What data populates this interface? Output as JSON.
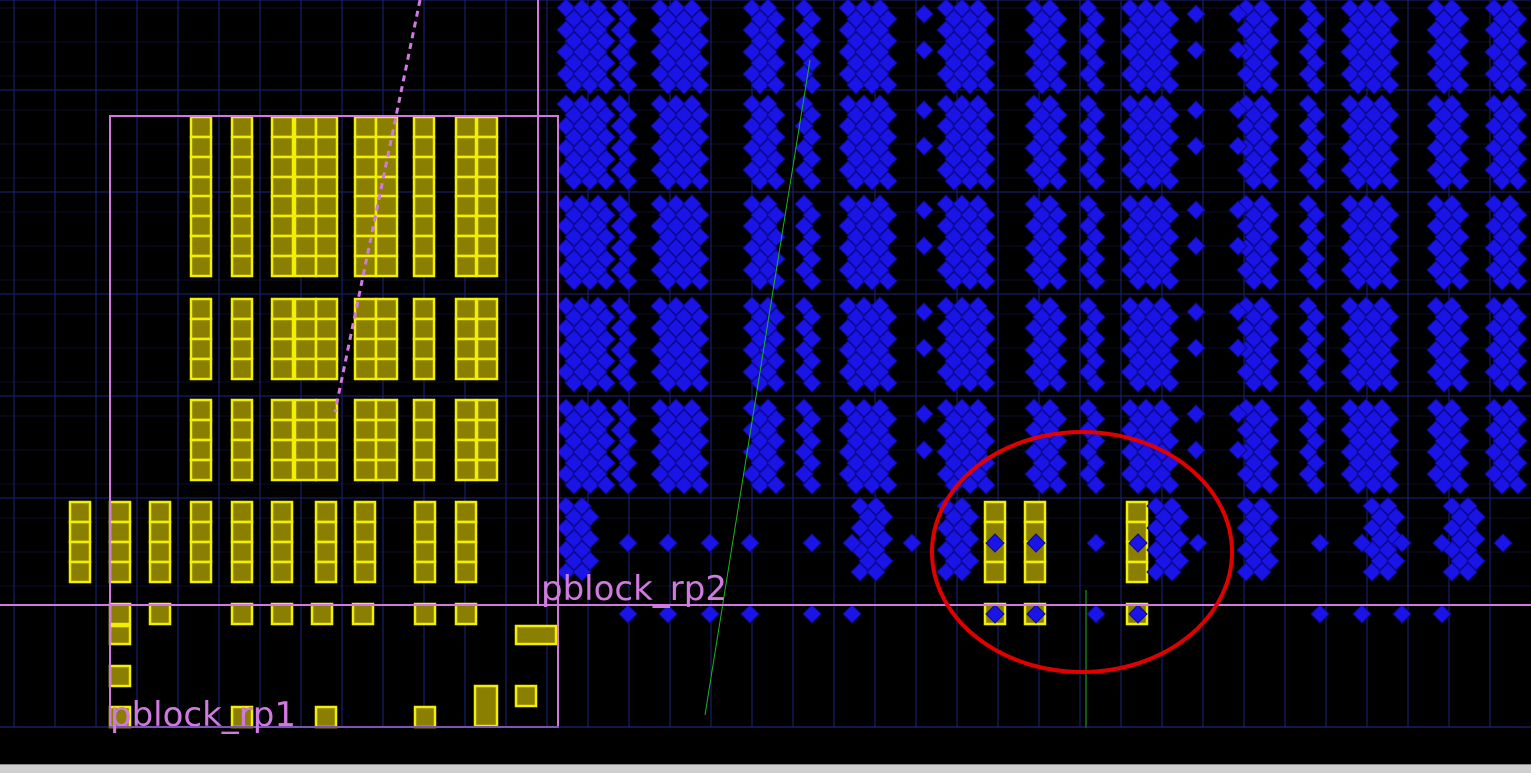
{
  "device_view": {
    "background": "#000000",
    "colors": {
      "grid": "#1a237e",
      "grid_fine": "#2a2f8a",
      "pblock_outline": "#d07ae0",
      "pblock_label": "#d07ae0",
      "rp1_cell_fill": "#8a7f00",
      "rp1_cell_stroke": "#f2ef00",
      "rp2_cell_fill": "#1a14e6",
      "rp2_cell_stroke": "#0d0a90",
      "highlight_circle": "#e00000",
      "net_line": "#1fb31f"
    },
    "pblocks": [
      {
        "label": "pblock_rp1"
      },
      {
        "label": "pblock_rp2"
      }
    ],
    "annotation": {
      "shape": "ellipse",
      "meaning": "highlight"
    }
  }
}
